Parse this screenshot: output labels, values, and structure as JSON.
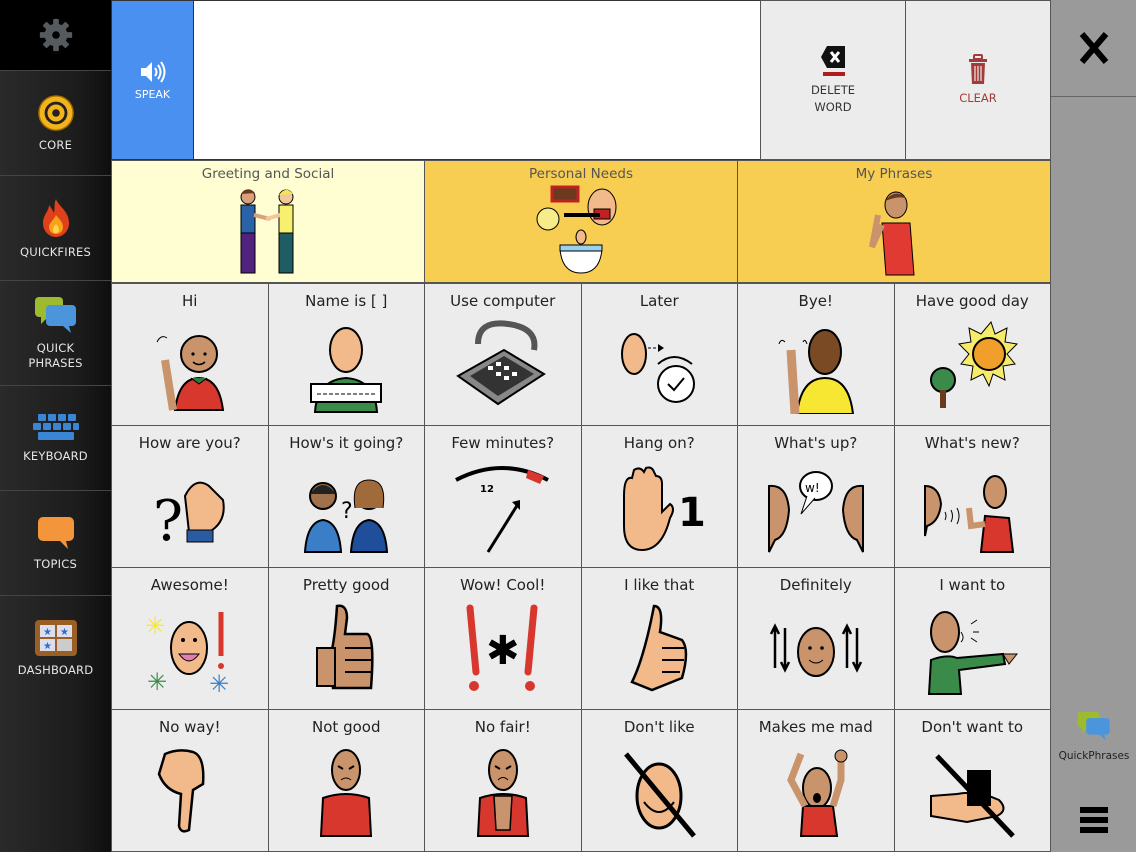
{
  "sidebar": {
    "settings_icon": "gear-icon",
    "items": [
      {
        "label": "CORE",
        "icon": "target-icon"
      },
      {
        "label": "QUICKFIRES",
        "icon": "flame-icon"
      },
      {
        "label": "QUICK\nPHRASES",
        "label_line1": "QUICK",
        "label_line2": "PHRASES",
        "icon": "speech-bubbles-icon"
      },
      {
        "label": "KEYBOARD",
        "icon": "keyboard-icon"
      },
      {
        "label": "TOPICS",
        "icon": "speech-bubble-icon"
      },
      {
        "label": "DASHBOARD",
        "icon": "dashboard-grid-icon"
      }
    ]
  },
  "toolbar": {
    "speak_label": "SPEAK",
    "message_value": "",
    "delete_word_line1": "DELETE",
    "delete_word_line2": "WORD",
    "clear_label": "CLEAR"
  },
  "right_panel": {
    "close_icon": "close-icon",
    "quickphrases_label": "QuickPhrases",
    "menu_icon": "hamburger-menu-icon"
  },
  "categories": [
    {
      "label": "Greeting and Social",
      "bg": "#fffdd2",
      "icon": "handshake-icon"
    },
    {
      "label": "Personal Needs",
      "bg": "#f7cd52",
      "icon": "hygiene-icon"
    },
    {
      "label": "My Phrases",
      "bg": "#f7cd52",
      "icon": "boy-pointing-self-icon"
    }
  ],
  "phrases": [
    {
      "label": "Hi",
      "icon": "waving-person-icon"
    },
    {
      "label": "Name is [  ]",
      "icon": "name-tag-person-icon"
    },
    {
      "label": "Use computer",
      "icon": "keypad-icon"
    },
    {
      "label": "Later",
      "icon": "later-clock-icon"
    },
    {
      "label": "Bye!",
      "icon": "waving-back-icon"
    },
    {
      "label": "Have good day",
      "icon": "sun-tree-icon"
    },
    {
      "label": "How are you?",
      "icon": "question-pointing-icon"
    },
    {
      "label": "How's it going?",
      "icon": "two-people-question-icon"
    },
    {
      "label": "Few minutes?",
      "icon": "clock-dial-icon"
    },
    {
      "label": "Hang on?",
      "icon": "hand-one-icon"
    },
    {
      "label": "What's up?",
      "icon": "faces-speech-icon"
    },
    {
      "label": "What's new?",
      "icon": "calling-person-icon"
    },
    {
      "label": "Awesome!",
      "icon": "happy-face-sparkles-icon"
    },
    {
      "label": "Pretty good",
      "icon": "thumbs-up-icon"
    },
    {
      "label": "Wow! Cool!",
      "icon": "exclamation-star-icon"
    },
    {
      "label": "I like that",
      "icon": "thumbs-up-light-icon"
    },
    {
      "label": "Definitely",
      "icon": "head-nod-icon"
    },
    {
      "label": "I want to",
      "icon": "pointing-person-icon"
    },
    {
      "label": "No way!",
      "icon": "thumbs-down-icon"
    },
    {
      "label": "Not good",
      "icon": "frowning-person-icon"
    },
    {
      "label": "No fair!",
      "icon": "angry-stop-person-icon"
    },
    {
      "label": "Don't like",
      "icon": "no-smile-icon"
    },
    {
      "label": "Makes me mad",
      "icon": "mad-person-icon"
    },
    {
      "label": "Don't want to",
      "icon": "no-hand-icon"
    }
  ]
}
